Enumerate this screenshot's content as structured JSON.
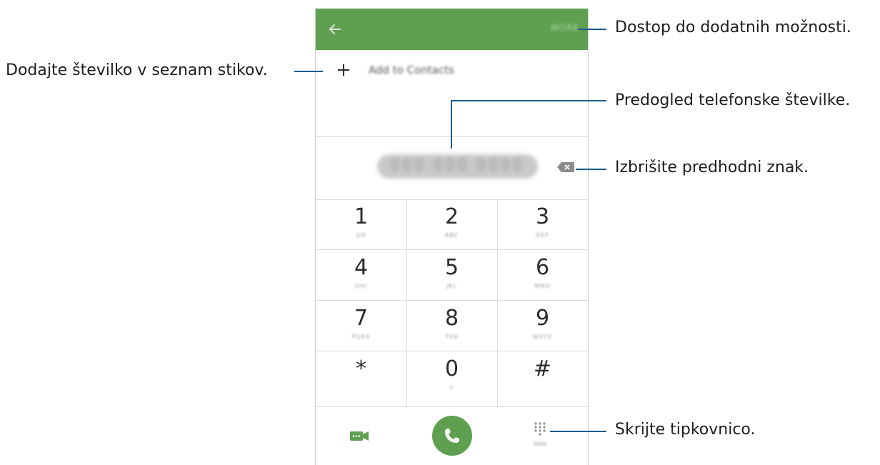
{
  "dialer": {
    "more_label": "MORE",
    "add_to_contacts": "Add to Contacts",
    "number_preview": "000 000 0000",
    "hide_label": "Hide",
    "keys": [
      {
        "digit": "1",
        "letters": "QD"
      },
      {
        "digit": "2",
        "letters": "ABC"
      },
      {
        "digit": "3",
        "letters": "DEF"
      },
      {
        "digit": "4",
        "letters": "GHI"
      },
      {
        "digit": "5",
        "letters": "JKL"
      },
      {
        "digit": "6",
        "letters": "MNO"
      },
      {
        "digit": "7",
        "letters": "PQRS"
      },
      {
        "digit": "8",
        "letters": "TUV"
      },
      {
        "digit": "9",
        "letters": "WXYZ"
      },
      {
        "digit": "*",
        "letters": ""
      },
      {
        "digit": "0",
        "letters": "+"
      },
      {
        "digit": "#",
        "letters": ""
      }
    ]
  },
  "annotations": {
    "more_options": "Dostop do dodatnih možnosti.",
    "add_contact": "Dodajte številko v seznam stikov.",
    "number_preview": "Predogled telefonske številke.",
    "delete_char": "Izbrišite predhodni znak.",
    "hide_keypad": "Skrijte tipkovnico."
  },
  "colors": {
    "accent": "#5ea04f",
    "leader_line": "#1a5c8c"
  }
}
